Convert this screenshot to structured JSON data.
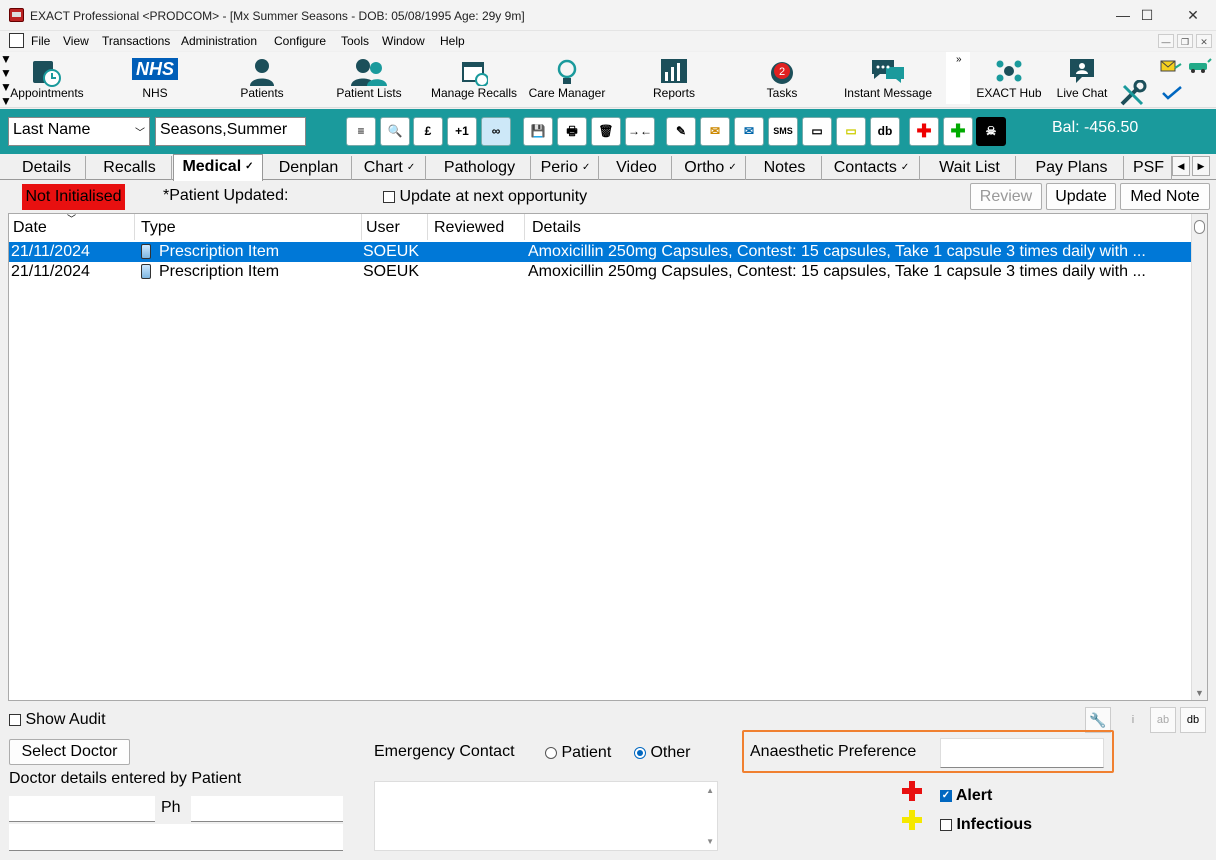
{
  "window": {
    "title": "EXACT Professional <PRODCOM> - [Mx Summer Seasons - DOB: 05/08/1995 Age: 29y 9m]",
    "minimize": "—",
    "maximize": "☐",
    "close": "✕"
  },
  "menu": [
    "File",
    "View",
    "Transactions",
    "Administration",
    "Configure",
    "Tools",
    "Window",
    "Help"
  ],
  "toolbar": [
    {
      "label": "Appointments",
      "icon": "appointments-icon"
    },
    {
      "label": "NHS",
      "icon": "nhs-logo"
    },
    {
      "label": "Patients",
      "icon": "patient-icon"
    },
    {
      "label": "Patient Lists",
      "icon": "patient-lists-icon"
    },
    {
      "label": "Manage Recalls",
      "icon": "calendar-icon"
    },
    {
      "label": "Care Manager",
      "icon": "lightbulb-icon"
    },
    {
      "label": "Reports",
      "icon": "chart-icon"
    },
    {
      "label": "Tasks",
      "icon": "alarm-clock-icon",
      "badge": "2"
    },
    {
      "label": "Instant Message",
      "icon": "chat-bubbles-icon"
    },
    {
      "label": "EXACT Hub",
      "icon": "hub-icon"
    },
    {
      "label": "Live Chat",
      "icon": "live-chat-icon"
    }
  ],
  "nhs_logo_text": "NHS",
  "overflow_chevron": "»",
  "search": {
    "field_select": "Last Name",
    "value": "Seasons,Summer",
    "balance": "Bal: -456.50",
    "buttons": [
      "≡",
      "🔍",
      "£",
      "+1",
      "∞",
      "💾",
      "🖶",
      "🗑",
      "→←",
      "✎",
      "✉",
      "✉",
      "SMS",
      "▭",
      "▭",
      "db",
      "✚",
      "✚",
      "☠"
    ]
  },
  "tabs": [
    {
      "label": "Details",
      "check": false
    },
    {
      "label": "Recalls",
      "check": false
    },
    {
      "label": "Medical",
      "check": true,
      "active": true
    },
    {
      "label": "Denplan",
      "check": false
    },
    {
      "label": "Chart",
      "check": true
    },
    {
      "label": "Pathology",
      "check": false
    },
    {
      "label": "Perio",
      "check": true
    },
    {
      "label": "Video",
      "check": false
    },
    {
      "label": "Ortho",
      "check": true
    },
    {
      "label": "Notes",
      "check": false
    },
    {
      "label": "Contacts",
      "check": true
    },
    {
      "label": "Wait List",
      "check": false
    },
    {
      "label": "Pay Plans",
      "check": false
    },
    {
      "label": "PSF",
      "check": false
    }
  ],
  "tab_check": "✓",
  "info": {
    "status": "Not Initialised",
    "status_color": "#e81010",
    "patient_updated": "*Patient Updated:",
    "update_next": "Update at next opportunity",
    "review": "Review",
    "update": "Update",
    "med_note": "Med Note"
  },
  "grid": {
    "columns": [
      "Date",
      "Type",
      "User",
      "Reviewed",
      "Details"
    ],
    "rows": [
      {
        "date": "21/11/2024",
        "type": "Prescription Item",
        "user": "SOEUK",
        "reviewed": "",
        "details": "Amoxicillin 250mg Capsules, Contest: 15 capsules, Take 1 capsule 3 times daily with ...",
        "selected": true
      },
      {
        "date": "21/11/2024",
        "type": "Prescription Item",
        "user": "SOEUK",
        "reviewed": "",
        "details": "Amoxicillin 250mg Capsules, Contest: 15 capsules, Take 1 capsule 3 times daily with ...",
        "selected": false
      }
    ]
  },
  "bottom": {
    "show_audit": "Show Audit",
    "select_doctor": "Select Doctor",
    "doctor_details": "Doctor details entered by Patient",
    "ph": "Ph",
    "emergency_contact": "Emergency Contact",
    "radio_patient": "Patient",
    "radio_other": "Other",
    "anaesthetic": "Anaesthetic Preference",
    "highlight_color": "#f08030",
    "alert": "Alert",
    "infectious": "Infectious",
    "tool_buttons": [
      "🔧",
      "i",
      "ab",
      "db"
    ]
  }
}
